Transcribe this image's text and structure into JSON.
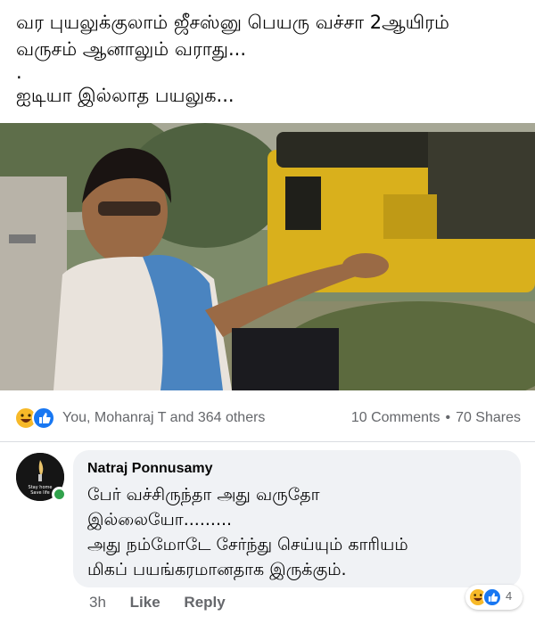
{
  "post": {
    "lines": [
      "வர புயலுக்குலாம் ஜீசஸ்னு பெயரு வச்சா 2ஆயிரம்",
      "வருசம் ஆனாலும் வராது...",
      ".",
      "ஐடியா இல்லாத பயலுக..."
    ]
  },
  "reactions": {
    "icons": [
      "haha-icon",
      "like-icon"
    ],
    "names": "You, Mohanraj T and 364 others",
    "comments": "10 Comments",
    "separator": "•",
    "shares": "70 Shares"
  },
  "comment": {
    "author": "Natraj Ponnusamy",
    "avatar_text": [
      "Stay home",
      "Save life"
    ],
    "lines": [
      "பேர் வச்சிருந்தா அது வருதோ",
      "இல்லையோ.........",
      "அது நம்மோடே சேர்ந்து செய்யும் காரியம்",
      "மிகப் பயங்கரமானதாக இருக்கும்."
    ],
    "time": "3h",
    "like_label": "Like",
    "reply_label": "Reply",
    "reaction_count": "4"
  },
  "colors": {
    "like_blue": "#1877f2",
    "haha_yellow": "#f7b928",
    "online_green": "#31a24c",
    "bubble_bg": "#f0f2f5",
    "secondary_text": "#65676b"
  }
}
